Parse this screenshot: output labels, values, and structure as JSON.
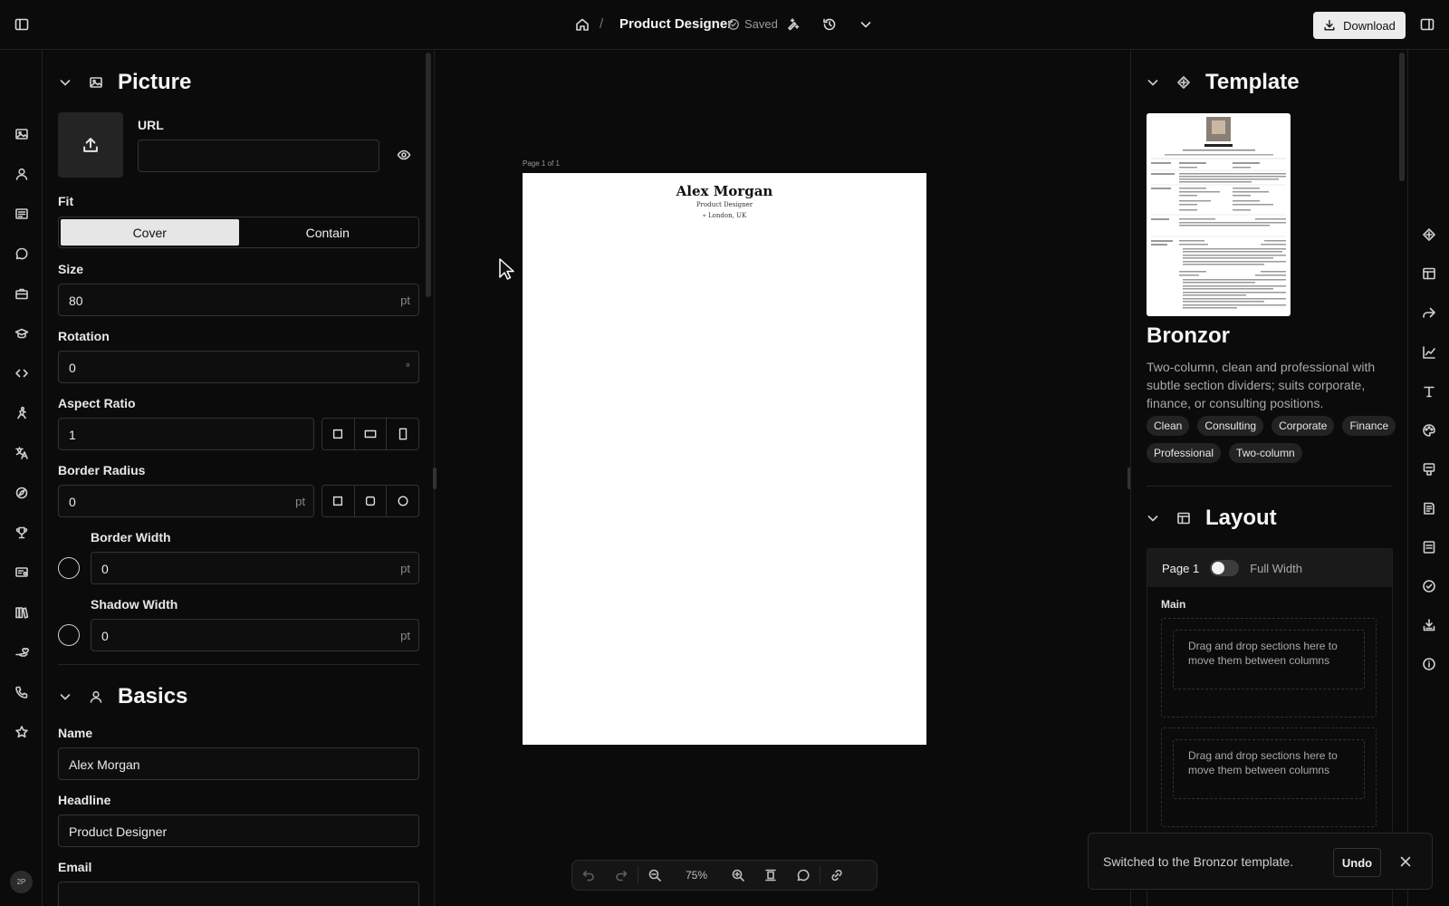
{
  "topbar": {
    "breadcrumb_sep": "/",
    "title": "Product Designer",
    "saved": "Saved",
    "download": "Download"
  },
  "left_rail": {
    "icons": [
      "sidebar-toggle-icon",
      "picture-icon",
      "user-icon",
      "summary-icon",
      "chat-icon",
      "briefcase-icon",
      "graduation-cap-icon",
      "code-icon",
      "skills-icon",
      "language-icon",
      "interests-icon",
      "trophy-icon",
      "certificate-icon",
      "books-icon",
      "volunteer-icon",
      "phone-icon",
      "star-icon"
    ],
    "avatar": "2P"
  },
  "picture": {
    "title": "Picture",
    "url_label": "URL",
    "url_value": "",
    "fit_label": "Fit",
    "fit_options": [
      "Cover",
      "Contain"
    ],
    "fit_selected": "Cover",
    "size_label": "Size",
    "size_value": "80",
    "size_unit": "pt",
    "rotation_label": "Rotation",
    "rotation_value": "0",
    "rotation_unit": "°",
    "aspect_label": "Aspect Ratio",
    "aspect_value": "1",
    "radius_label": "Border Radius",
    "radius_value": "0",
    "radius_unit": "pt",
    "border_width_label": "Border Width",
    "border_width_value": "0",
    "border_width_unit": "pt",
    "shadow_width_label": "Shadow Width",
    "shadow_width_value": "0",
    "shadow_width_unit": "pt"
  },
  "basics": {
    "title": "Basics",
    "name_label": "Name",
    "name_value": "Alex Morgan",
    "headline_label": "Headline",
    "headline_value": "Product Designer",
    "email_label": "Email",
    "email_value": ""
  },
  "canvas": {
    "page_label": "Page 1 of 1",
    "resume_name": "Alex Morgan",
    "resume_headline": "Product Designer",
    "resume_location": "London, UK",
    "zoom": "75%"
  },
  "template": {
    "title": "Template",
    "name": "Bronzor",
    "description": "Two-column, clean and professional with subtle section dividers; suits corporate, finance, or consulting positions.",
    "tags": [
      "Clean",
      "Consulting",
      "Corporate",
      "Finance",
      "Professional",
      "Two-column"
    ]
  },
  "layout": {
    "title": "Layout",
    "page_label": "Page 1",
    "full_width_label": "Full Width",
    "full_width_on": false,
    "main_label": "Main",
    "dropzone_text": "Drag and drop sections here to move them between columns"
  },
  "toast": {
    "message": "Switched to the Bronzor template.",
    "undo": "Undo"
  },
  "colors": {
    "background": "#0b0b0b",
    "panel_border": "#222222",
    "button_light": "#ececec"
  }
}
